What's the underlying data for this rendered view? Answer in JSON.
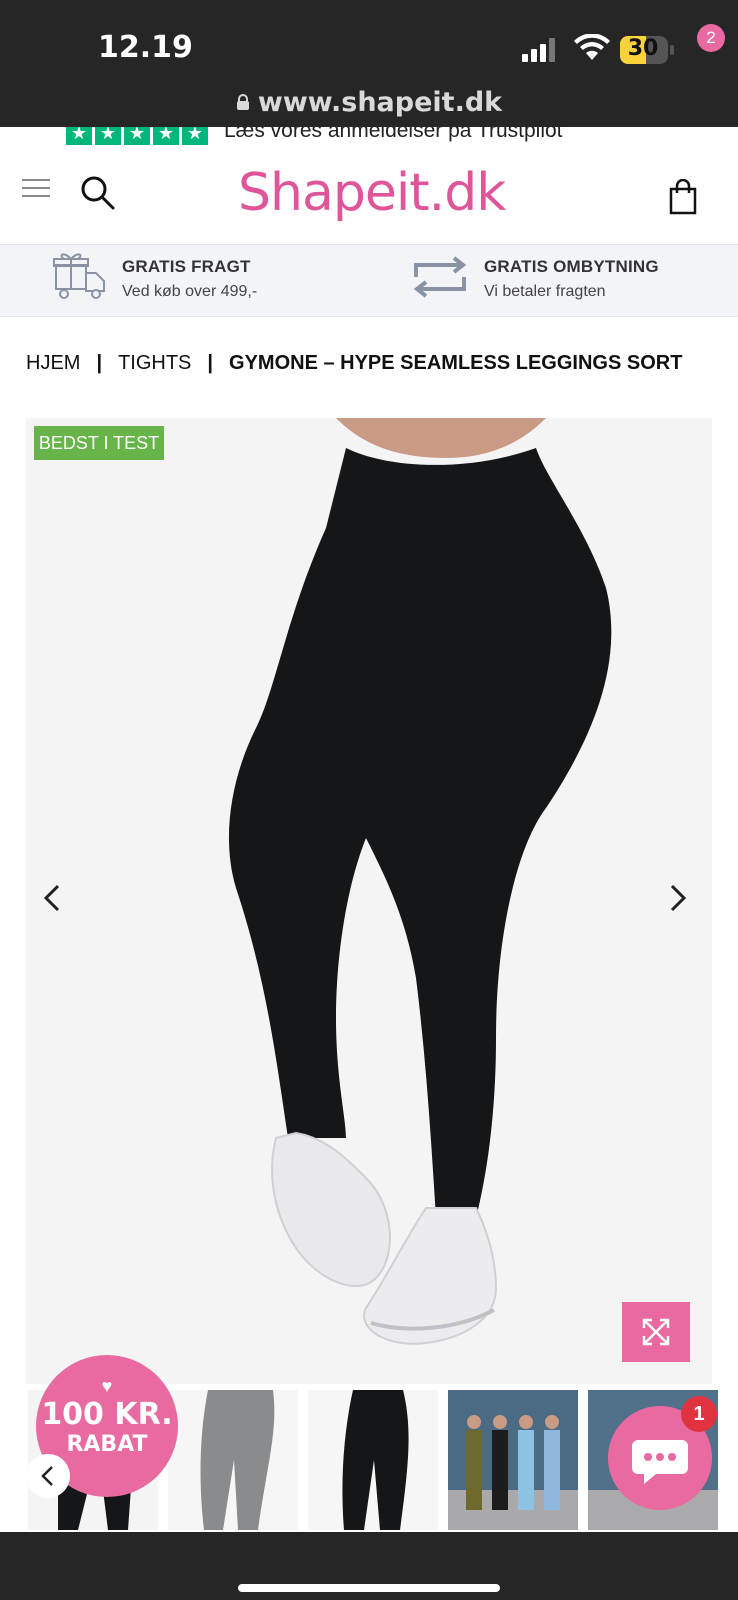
{
  "status_bar": {
    "time": "12.19",
    "battery": "30"
  },
  "browser": {
    "url": "www.shapeit.dk"
  },
  "trustpilot": {
    "text": "Læs vores anmeldelser på Trustpilot",
    "stars": [
      "★",
      "★",
      "★",
      "★",
      "★"
    ]
  },
  "header": {
    "logo": "Shapeit.dk",
    "cart_count": "2"
  },
  "usp": [
    {
      "title": "GRATIS FRAGT",
      "sub": "Ved køb over 499,-",
      "icon": "gift-truck-icon"
    },
    {
      "title": "GRATIS OMBYTNING",
      "sub": "Vi betaler fragten",
      "icon": "exchange-arrows-icon"
    }
  ],
  "breadcrumb": {
    "home": "HJEM",
    "category": "TIGHTS",
    "current": "GYMONE – HYPE SEAMLESS LEGGINGS SORT"
  },
  "product": {
    "badge": "BEDST I TEST"
  },
  "promo": {
    "heart": "♥",
    "line1": "100 KR.",
    "line2": "RABAT"
  },
  "chat": {
    "badge": "1"
  },
  "colors": {
    "accent": "#e86aa0",
    "badge_green": "#67b549",
    "trust_green": "#00b67a"
  }
}
